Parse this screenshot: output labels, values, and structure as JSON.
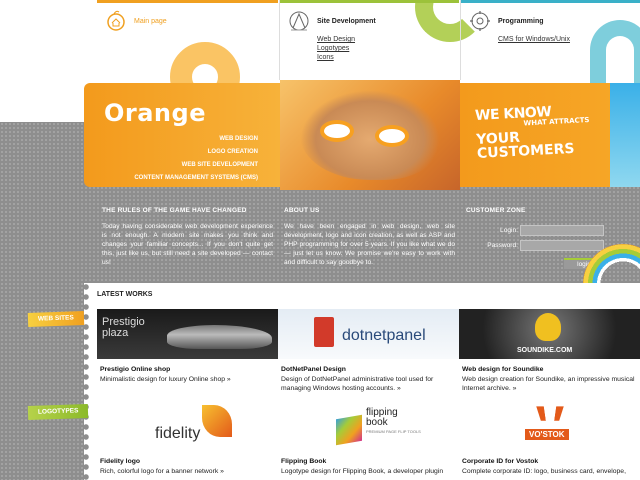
{
  "nav": {
    "main_page": "Main page",
    "site_development": {
      "title": "Site Development",
      "links": [
        "Web Design",
        "Logotypes",
        "Icons"
      ]
    },
    "programming": {
      "title": "Programming",
      "links": [
        "CMS for Windows/Unix"
      ]
    }
  },
  "banner": {
    "logo": "Orange",
    "menu": [
      "WEB DESIGN",
      "LOGO CREATION",
      "WEB SITE DEVELOPMENT",
      "CONTENT MANAGEMENT SYSTEMS (CMS)"
    ],
    "slogan": {
      "line1": "WE KNOW",
      "line2": "WHAT ATTRACTS",
      "line3": "YOUR",
      "line4": "CUSTOMERS"
    }
  },
  "info": {
    "rules": {
      "title": "THE RULES OF THE GAME HAVE CHANGED",
      "text": "Today having considerable web development experience is not enough. A modern site makes you think and changes your familiar concepts... If you don't quite get this, just like us, but still need a site developed — contact us!"
    },
    "about": {
      "title": "ABOUT US",
      "text": "We have been engaged in web design, web site development, logo and icon creation, as well as ASP and PHP programming for over 5 years. If you like what we do — just let us know. We promise we're easy to work with and difficult to say goodbye to."
    },
    "customer_zone": {
      "title": "CUSTOMER ZONE",
      "login_label": "Login:",
      "password_label": "Password:",
      "login_button": "login"
    }
  },
  "works": {
    "title": "LATEST WORKS",
    "tags": {
      "web_sites": "WEB SITES",
      "logotypes": "LOGOTYPES"
    },
    "web_sites": [
      {
        "thumb_text": "Prestigio plaza",
        "title": "Prestigio Online shop",
        "desc": "Minimalistic design for luxury Online shop »"
      },
      {
        "thumb_text": "dotnetpanel",
        "title": "DotNetPanel Design",
        "desc": "Design of DotNetPanel administrative tool used for managing Windows hosting accounts. »"
      },
      {
        "thumb_text": "SOUNDIKE.COM",
        "title": "Web design for Soundike",
        "desc": "Web design creation for Soundike, an impressive musical Internet archive. »"
      }
    ],
    "logotypes": [
      {
        "thumb_text": "fidelity",
        "title": "Fidelity logo",
        "desc": "Rich, colorful logo for a banner network »"
      },
      {
        "thumb_text": "flipping book",
        "thumb_sub": "PREMIUM PAGE FLIP TOOLS",
        "title": "Flipping Book",
        "desc": "Logotype design for Flipping Book, a developer plugin"
      },
      {
        "thumb_text": "VO'STOK",
        "title": "Corporate ID for Vostok",
        "desc": "Complete corporate ID: logo, business card, envelope,"
      }
    ]
  }
}
